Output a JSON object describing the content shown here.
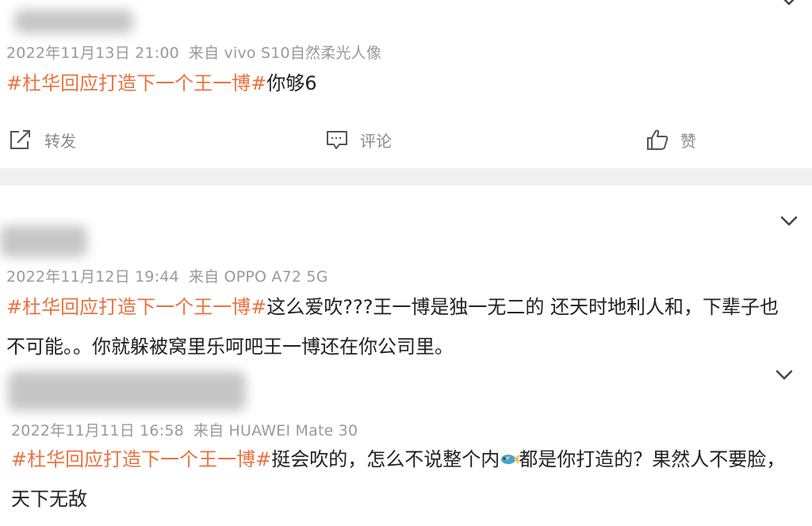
{
  "posts": [
    {
      "timestamp": "2022年11月13日 21:00",
      "source": "来自 vivo S10自然柔光人像",
      "hashtag": "#杜华回应打造下一个王一博#",
      "text": "你够6",
      "actions": {
        "repost": "转发",
        "comment": "评论",
        "like": "赞"
      }
    },
    {
      "timestamp": "2022年11月12日 19:44",
      "source": "来自 OPPO A72 5G",
      "hashtag": "#杜华回应打造下一个王一博#",
      "text": "这么爱吹???王一博是独一无二的 还天时地利人和，下辈子也不可能。。你就躲被窝里乐呵吧王一博还在你公司里。"
    },
    {
      "timestamp": "2022年11月11日 16:58",
      "source": "来自 HUAWEI Mate 30",
      "hashtag": "#杜华回应打造下一个王一博#",
      "text_before_emoji": "挺会吹的，怎么不说整个内",
      "text_after_emoji": "都是你打造的？果然人不要脸，天下无敌"
    }
  ],
  "colors": {
    "hashtag": "#eb7340",
    "meta": "#9a9a9a",
    "text": "#222222",
    "separator": "#f1f1f1"
  },
  "icons": [
    "repost-icon",
    "comment-icon",
    "like-icon",
    "chevron-down-icon",
    "fish-emoji-icon"
  ]
}
